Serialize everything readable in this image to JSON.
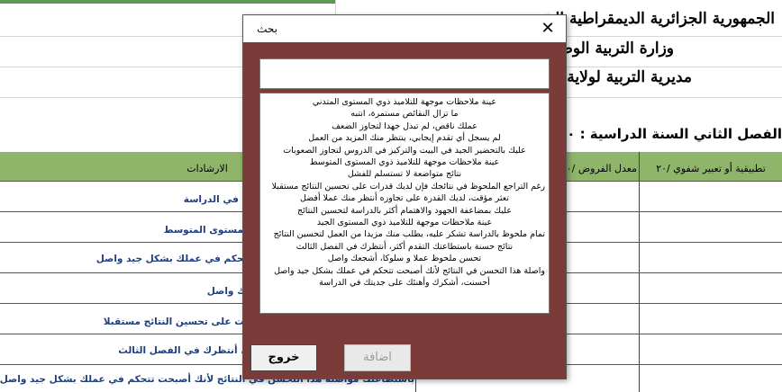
{
  "header": {
    "line1": "الجمهورية الجزائرية الديمقراطية الشعبية",
    "line2": "وزارة التربية الوطنية",
    "line3": "مديرية التربية لولاية سطيف"
  },
  "semester_title": "الفصل الثاني السنة الدراسية : ٢٠٢٠-",
  "table": {
    "col_advice": "الارشادات",
    "col_assess": "معدل الفروض /٢٠",
    "col_oral": "تطبيقية أو تعبير شفوي /٢٠",
    "col_misc": "/٢٠"
  },
  "rows": [
    "أحسنت، أشكرك وأهنئك على جديتك في الدراسة",
    "عينة ملاحظات موجهة للتلاميذ ذوي المستوى المتوسط",
    "إن التحسن في النتائج لأنك أصبحت تتحكم في عملك بشكل جيد واصل",
    "تحسن ملحوظ عملا و سلوكا، أشجعك واصل",
    "الملحوظ في نتائجك فإن لديك قدرات على تحسين النتائج مستقبلا",
    "نتائج حسنة باستطاعتك التقدم أكثر، أنتظرك في الفصل الثالث",
    "باستطاعتك مواصلة هذا التحسن في النتائج لأنك أصبحت تتحكم في عملك بشكل جيد واصل"
  ],
  "dialog": {
    "title": "بحث",
    "close_glyph": "✕",
    "search_value": "",
    "items": [
      "عينة ملاحظات موجهة للتلاميذ ذوي المستوى المتدني",
      "ما تزال النقائص مستمرة، انتبه",
      "عملك ناقص، لم تبذل جهدا لتجاوز الضعف",
      "لم يسجل أي تقدم إيجابي، ينتظر منك المزيد من العمل",
      "عليك بالتحضير الجيد في البيت والتركيز في الدروس لتجاوز الصعوبات",
      "عينة ملاحظات موجهة للتلاميذ ذوي المستوى المتوسط",
      "نتائج متواضعة لا تستسلم للفشل",
      "رغم التراجع الملحوظ في نتائجك فإن لديك قدرات على تحسين النتائج مستقبلا",
      "تعثر مؤقت، لديك القدرة على تجاوزه أنتظر منك عملا أفضل",
      "عليك بمضاعفة الجهود والاهتمام أكثر بالدراسة لتحسين النتائج",
      "عينة ملاحظات موجهة للتلاميذ ذوي المستوى الجيد",
      "تمام ملحوظ بالدراسة تشكر عليه، يطلب منك مزيدا من العمل لتحسين النتائج",
      "نتائج حسنة باستطاعتك التقدم أكثر، أنتظرك في الفصل الثالث",
      "تحسن ملحوظ عملا و سلوكا، أشجعك واصل",
      "واصلة هذا التحسن في النتائج لأنك أصبحت تتحكم في عملك بشكل جيد واصل",
      "أحسنت، أشكرك وأهنئك على جديتك في الدراسة"
    ],
    "exit_label": "خروج",
    "add_label": "اضافة"
  }
}
